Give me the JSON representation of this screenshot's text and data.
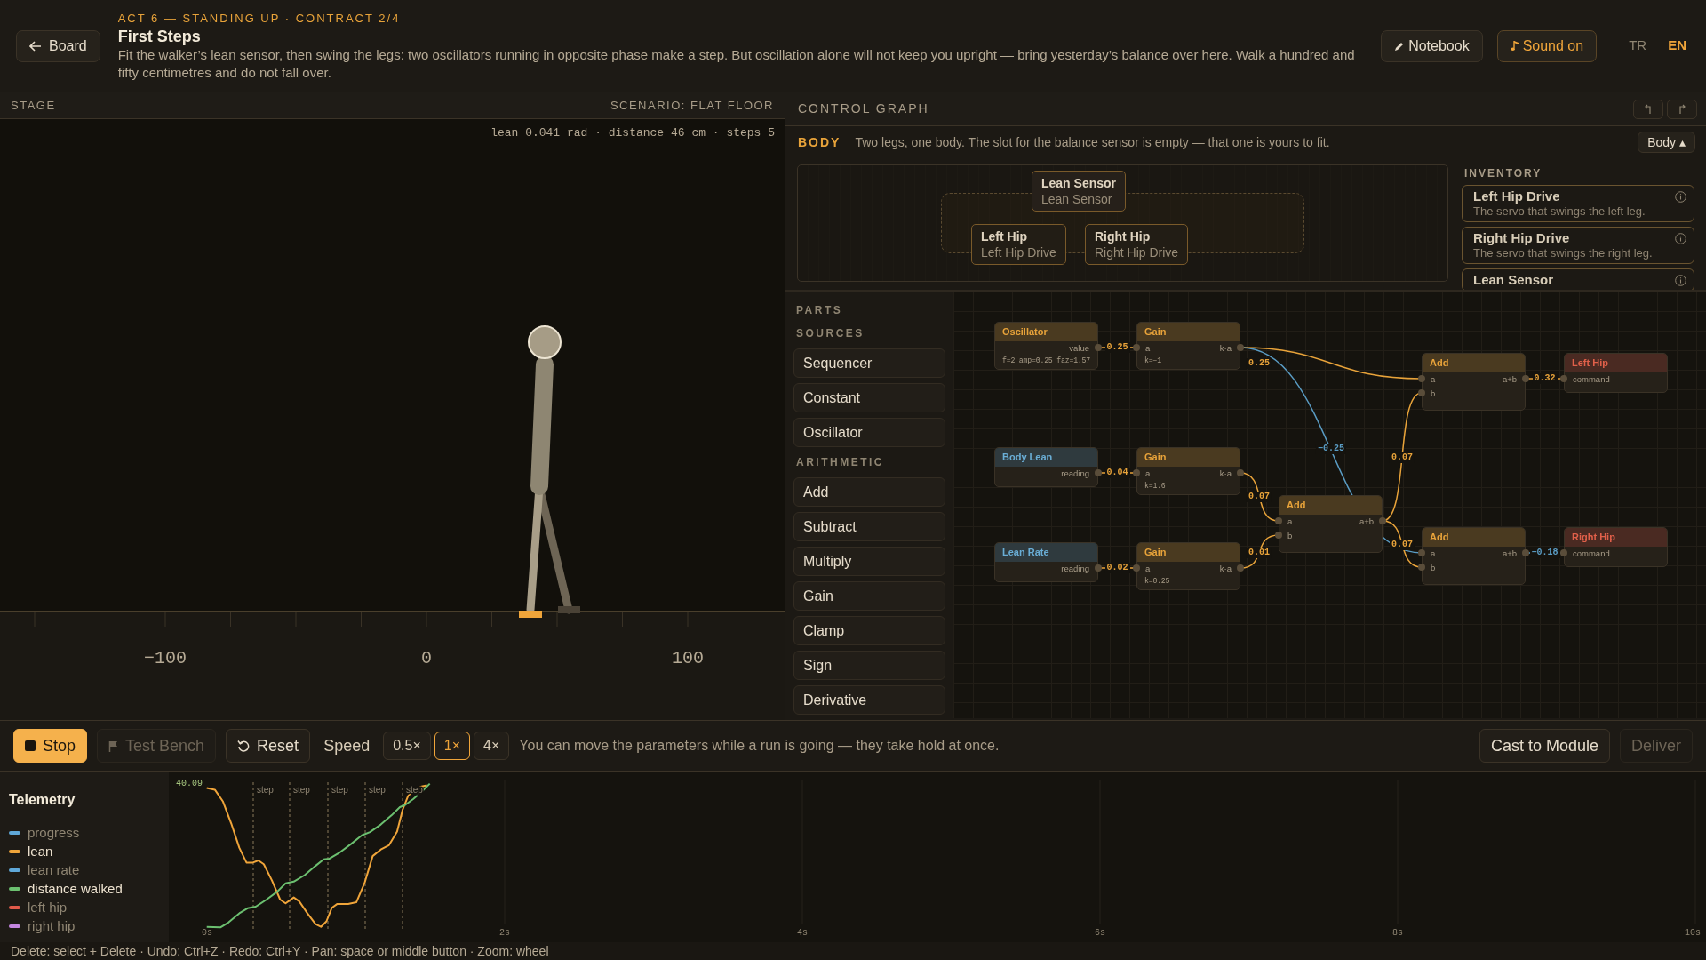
{
  "header": {
    "back_label": "Board",
    "kicker": "ACT 6 — STANDING UP · CONTRACT 2/4",
    "title": "First Steps",
    "description": "Fit the walker’s lean sensor, then swing the legs: two oscillators running in opposite phase make a step. But oscillation alone will not keep you upright — bring yesterday’s balance over here. Walk a hundred and fifty centimetres and do not fall over.",
    "buttons": [
      {
        "label": "Notebook",
        "kind": "notebook",
        "on": false
      },
      {
        "label": "Sound on",
        "kind": "sound",
        "on": true
      }
    ],
    "languages": [
      {
        "code": "TR",
        "selected": false
      },
      {
        "code": "EN",
        "selected": true
      }
    ]
  },
  "stage": {
    "title": "STAGE",
    "scenario": "SCENARIO: FLAT FLOOR",
    "readout": "lean 0.041 rad · distance 46 cm · steps 5",
    "ruler_labels": [
      "−100",
      "0",
      "100"
    ]
  },
  "control_graph": {
    "title": "CONTROL GRAPH",
    "body_label": "BODY",
    "body_description": "Two legs, one body. The slot for the balance sensor is empty — that one is yours to fit.",
    "body_toggle": "Body",
    "body_caret": "▴",
    "slots": [
      {
        "title": "Lean Sensor",
        "part": "Lean Sensor"
      },
      {
        "title": "Left Hip",
        "part": "Left Hip Drive"
      },
      {
        "title": "Right Hip",
        "part": "Right Hip Drive"
      }
    ],
    "inventory_title": "INVENTORY",
    "inventory": [
      {
        "title": "Left Hip Drive",
        "description": "The servo that swings the left leg."
      },
      {
        "title": "Right Hip Drive",
        "description": "The servo that swings the right leg."
      },
      {
        "title": "Lean Sensor"
      }
    ]
  },
  "parts": {
    "title": "PARTS",
    "groups": [
      {
        "title": "SOURCES",
        "items": [
          "Sequencer",
          "Constant",
          "Oscillator"
        ]
      },
      {
        "title": "ARITHMETIC",
        "items": [
          "Add",
          "Subtract",
          "Multiply",
          "Gain",
          "Clamp",
          "Sign",
          "Derivative"
        ]
      }
    ]
  },
  "graph": {
    "nodes": [
      {
        "title": "Oscillator",
        "kind": "source",
        "rows": [
          {
            "out": "value"
          }
        ],
        "param": "f=2 amp=0.25 faz=1.57"
      },
      {
        "title": "Gain",
        "kind": "op",
        "rows": [
          {
            "in": "a",
            "out": "k·a"
          }
        ],
        "param": "k=−1"
      },
      {
        "title": "Add",
        "kind": "op",
        "rows": [
          {
            "in": "a",
            "out": "a+b"
          },
          {
            "in": "b"
          }
        ]
      },
      {
        "title": "Left Hip",
        "kind": "actuator",
        "rows": [
          {
            "in": "command"
          }
        ]
      },
      {
        "title": "Body Lean",
        "kind": "sensor",
        "rows": [
          {
            "out": "reading"
          }
        ]
      },
      {
        "title": "Gain",
        "kind": "op",
        "rows": [
          {
            "in": "a",
            "out": "k·a"
          }
        ],
        "param": "k=1.6"
      },
      {
        "title": "Add",
        "kind": "op",
        "rows": [
          {
            "in": "a",
            "out": "a+b"
          },
          {
            "in": "b"
          }
        ]
      },
      {
        "title": "Lean Rate",
        "kind": "sensor",
        "rows": [
          {
            "out": "reading"
          }
        ]
      },
      {
        "title": "Gain",
        "kind": "op",
        "rows": [
          {
            "in": "a",
            "out": "k·a"
          }
        ],
        "param": "k=0.25"
      },
      {
        "title": "Add",
        "kind": "op",
        "rows": [
          {
            "in": "a",
            "out": "a+b"
          },
          {
            "in": "b"
          }
        ]
      },
      {
        "title": "Right Hip",
        "kind": "actuator",
        "rows": [
          {
            "in": "command"
          }
        ]
      }
    ],
    "wires": [
      {
        "label": "0.25",
        "color": "#e8a33a"
      },
      {
        "label": "0.25",
        "color": "#e8a33a"
      },
      {
        "label": "−0.25",
        "color": "#5a9cc4"
      },
      {
        "label": "0.04",
        "color": "#e8a33a"
      },
      {
        "label": "0.07",
        "color": "#e8a33a"
      },
      {
        "label": "0.02",
        "color": "#e8a33a"
      },
      {
        "label": "0.01",
        "color": "#e8a33a"
      },
      {
        "label": "0.07",
        "color": "#e8a33a"
      },
      {
        "label": "0.07",
        "color": "#e8a33a"
      },
      {
        "label": "0.32",
        "color": "#e8a33a"
      },
      {
        "label": "−0.18",
        "color": "#5a9cc4"
      }
    ]
  },
  "toolbar": {
    "buttons": [
      {
        "label": "Stop",
        "kind": "stop",
        "disabled": false
      },
      {
        "label": "Test Bench",
        "kind": "bench",
        "disabled": true
      },
      {
        "label": "Reset",
        "kind": "reset",
        "disabled": false
      }
    ],
    "speed_label": "Speed",
    "speeds": [
      {
        "label": "0.5×",
        "selected": false
      },
      {
        "label": "1×",
        "selected": true
      },
      {
        "label": "4×",
        "selected": false
      }
    ],
    "hint": "You can move the parameters while a run is going — they take hold at once.",
    "actions": [
      {
        "label": "Cast to Module",
        "disabled": false
      },
      {
        "label": "Deliver",
        "disabled": true
      }
    ]
  },
  "telemetry": {
    "title": "Telemetry",
    "series": [
      {
        "name": "progress",
        "color": "#5fa8d8",
        "on": false
      },
      {
        "name": "lean",
        "color": "#f0a53a",
        "on": true
      },
      {
        "name": "lean rate",
        "color": "#5fa8d8",
        "on": false
      },
      {
        "name": "distance walked",
        "color": "#6cc070",
        "on": true
      },
      {
        "name": "left hip",
        "color": "#e05a4a",
        "on": false
      },
      {
        "name": "right hip",
        "color": "#c486e0",
        "on": false
      }
    ],
    "peak_label": "40.09",
    "step_labels": [
      "step",
      "step",
      "step",
      "step",
      "step"
    ],
    "x_labels": [
      "0s",
      "2s",
      "4s",
      "6s",
      "8s",
      "10s"
    ]
  },
  "status_bar": "Delete: select + Delete · Undo: Ctrl+Z · Redo: Ctrl+Y · Pan: space or middle button · Zoom: wheel"
}
